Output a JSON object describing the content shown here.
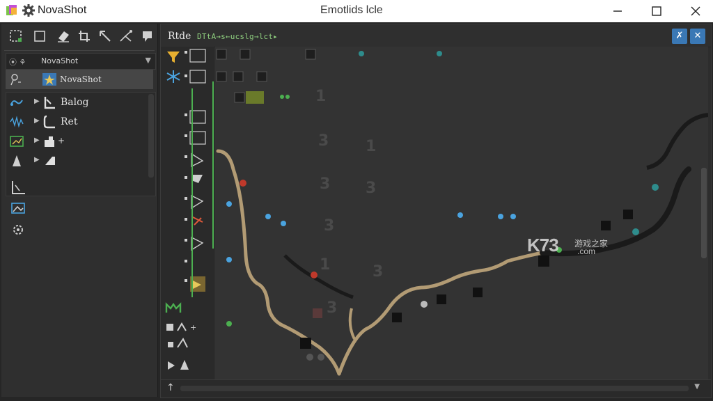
{
  "app": {
    "name": "NovaShot"
  },
  "window": {
    "title": "Emotlids lcle"
  },
  "left_panel": {
    "combo": {
      "icon_text": "⦿ ⚘",
      "value": "NovaShot"
    },
    "tree": [
      {
        "label": "NovaShot",
        "selected": true,
        "icon": "star-icon"
      },
      {
        "label": "Balog",
        "selected": false,
        "icon": "bracket-icon"
      },
      {
        "label": "Ret",
        "selected": false,
        "icon": "bracket-icon"
      },
      {
        "label": "+",
        "selected": false,
        "icon": "puzzle-icon"
      },
      {
        "label": "",
        "selected": false,
        "icon": "wedge-icon"
      }
    ]
  },
  "main_panel": {
    "title": "Rtde",
    "subtitle": "DTtA→s←ucslg→lct▸"
  },
  "watermark": {
    "brand": "K73",
    "cn": "游戏之家",
    "domain": ".com"
  },
  "colors": {
    "accent": "#3a78b5",
    "track_green": "#4caf50",
    "path_tan": "#b29b74",
    "node_teal": "#2e8c8c"
  }
}
